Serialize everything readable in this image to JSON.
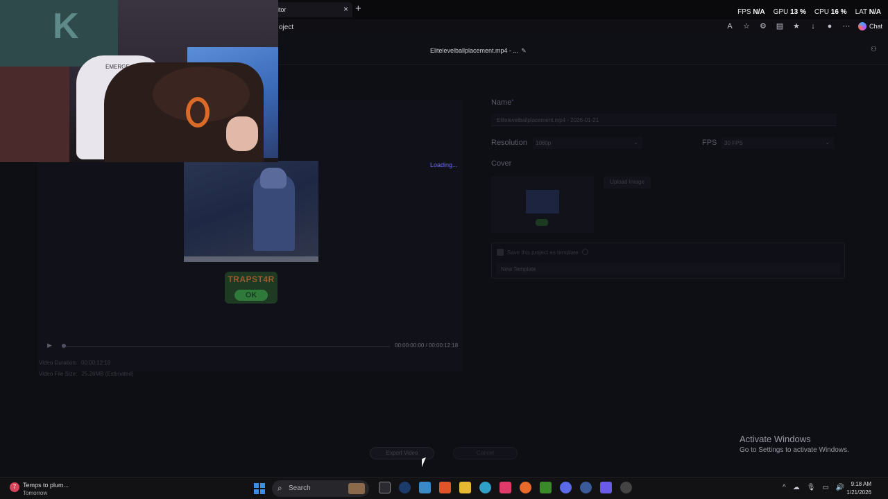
{
  "browser": {
    "tab_title": "itor",
    "address_fragment": "oject",
    "chat_label": "Chat"
  },
  "perf": {
    "fps_label": "FPS",
    "fps_value": "N/A",
    "gpu_label": "GPU",
    "gpu_value": "13 %",
    "cpu_label": "CPU",
    "cpu_value": "16 %",
    "lat_label": "LAT",
    "lat_value": "N/A"
  },
  "app": {
    "project_title": "Elitelevelballplacement.mp4 - ...",
    "loading": "Loading...",
    "watermark_text": "TRAPST4R",
    "watermark_badge": "OK",
    "timecode": "00:00:00:00 / 00:00:12:18",
    "video_duration_label": "Video Duration:",
    "video_duration_value": "00:00:12:18",
    "video_size_label": "Video File Size:",
    "video_size_value": "25.26MB (Estimated)"
  },
  "form": {
    "name_label": "Name",
    "name_required": "*",
    "name_value": "Elitelevelballplacement.mp4 - 2026-01-21",
    "resolution_label": "Resolution",
    "resolution_value": "1080p",
    "fps_label": "FPS",
    "fps_value": "30 FPS",
    "cover_label": "Cover",
    "upload_button": "Upload Image",
    "template_checkbox_label": "Save this project as template",
    "template_placeholder": "New Template"
  },
  "actions": {
    "export": "Export Video",
    "cancel": "Cancel"
  },
  "watermark_os": {
    "line1": "Activate Windows",
    "line2": "Go to Settings to activate Windows."
  },
  "taskbar": {
    "weather_line1": "Temps to plum...",
    "weather_line2": "Tomorrow",
    "weather_badge": "7",
    "search_text": "Search",
    "time": "9:18 AM",
    "date": "1/21/2026"
  },
  "webcam": {
    "chair_logo": "EMERGE"
  },
  "colors": {
    "accent": "#6f6bff",
    "windows_blue": "#3b8de8",
    "background": "#0e0e15"
  }
}
